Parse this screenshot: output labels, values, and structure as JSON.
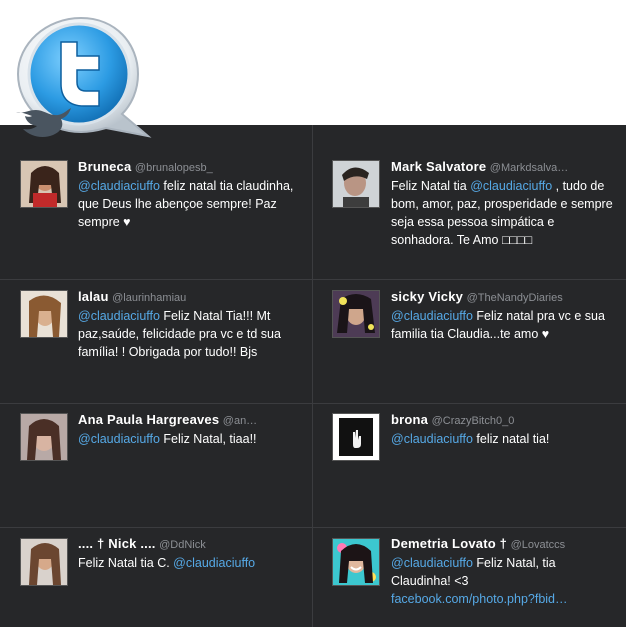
{
  "logo": {
    "name": "twitter-bubble-logo"
  },
  "tweets": [
    {
      "name": "Bruneca",
      "handle": "@brunalopesb_",
      "mention": "@claudiaciuffo",
      "text": " feliz natal tia claudinha, que Deus lhe abençoe sempre! Paz sempre ♥"
    },
    {
      "name": "Mark Salvatore",
      "handle": "@Markdsalva…",
      "prefix": "Feliz Natal tia ",
      "mention": "@claudiaciuffo",
      "text": " , tudo de bom, amor, paz, prosperidade e sempre seja essa pessoa simpática e sonhadora. Te Amo □□□□"
    },
    {
      "name": "lalau",
      "handle": "@laurinhamiau",
      "mention": "@claudiaciuffo",
      "text": " Feliz Natal Tia!!! Mt paz,saúde, felicidade pra vc e td sua família! ! Obrigada por tudo!! Bjs"
    },
    {
      "name": "sicky Vicky",
      "handle": "@TheNandyDiaries",
      "mention": "@claudiaciuffo",
      "text": " Feliz natal pra vc e sua familia tia Claudia...te amo ♥"
    },
    {
      "name": "Ana Paula Hargreaves",
      "handle": "@an…",
      "mention": "@claudiaciuffo",
      "text": " Feliz Natal, tiaa!!"
    },
    {
      "name": "brona",
      "handle": "@CrazyBitch0_0",
      "mention": "@claudiaciuffo",
      "text": " feliz natal tia!"
    },
    {
      "name": ".... † Nick ....",
      "handle": "@DdNick",
      "prefix": "Feliz Natal tia C. ",
      "mention": "@claudiaciuffo",
      "text": ""
    },
    {
      "name": "Demetria Lovato †",
      "handle": "@Lovatccs",
      "mention": "@claudiaciuffo",
      "text": " Feliz Natal, tia Claudinha! <3",
      "link": "facebook.com/photo.php?fbid…"
    }
  ],
  "colors": {
    "background": "#262729",
    "mention": "#56a9e6",
    "handle": "#8c8f94",
    "logo_blue": "#3a9ee0"
  }
}
